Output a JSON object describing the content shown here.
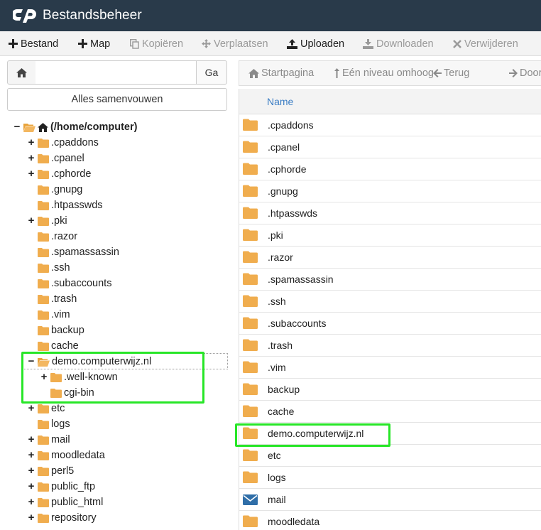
{
  "app": {
    "title": "Bestandsbeheer"
  },
  "toolbar": {
    "file": "Bestand",
    "folder": "Map",
    "copy": "Kopiëren",
    "move": "Verplaatsen",
    "upload": "Uploaden",
    "download": "Downloaden",
    "delete": "Verwijderen"
  },
  "left": {
    "path_value": "",
    "go_label": "Ga",
    "collapse_label": "Alles samenvouwen"
  },
  "tree": {
    "root": "(/home/computer)",
    "nodes": [
      {
        "label": ".cpaddons",
        "expandable": true
      },
      {
        "label": ".cpanel",
        "expandable": true
      },
      {
        "label": ".cphorde",
        "expandable": true
      },
      {
        "label": ".gnupg",
        "expandable": false
      },
      {
        "label": ".htpasswds",
        "expandable": false
      },
      {
        "label": ".pki",
        "expandable": true
      },
      {
        "label": ".razor",
        "expandable": false
      },
      {
        "label": ".spamassassin",
        "expandable": false
      },
      {
        "label": ".ssh",
        "expandable": false
      },
      {
        "label": ".subaccounts",
        "expandable": false
      },
      {
        "label": ".trash",
        "expandable": false
      },
      {
        "label": ".vim",
        "expandable": false
      },
      {
        "label": "backup",
        "expandable": false
      },
      {
        "label": "cache",
        "expandable": false
      },
      {
        "label": "demo.computerwijz.nl",
        "expandable": true,
        "expanded": true
      },
      {
        "label": ".well-known",
        "expandable": true,
        "child": true
      },
      {
        "label": "cgi-bin",
        "expandable": false,
        "child": true
      },
      {
        "label": "etc",
        "expandable": true
      },
      {
        "label": "logs",
        "expandable": false
      },
      {
        "label": "mail",
        "expandable": true
      },
      {
        "label": "moodledata",
        "expandable": true
      },
      {
        "label": "perl5",
        "expandable": true
      },
      {
        "label": "public_ftp",
        "expandable": true
      },
      {
        "label": "public_html",
        "expandable": true
      },
      {
        "label": "repository",
        "expandable": true
      }
    ]
  },
  "nav": {
    "home": "Startpagina",
    "up": "Eén niveau omhoog",
    "back": "Terug",
    "forward": "Door"
  },
  "table": {
    "col_name": "Name",
    "rows": [
      {
        "name": ".cpaddons",
        "type": "folder"
      },
      {
        "name": ".cpanel",
        "type": "folder"
      },
      {
        "name": ".cphorde",
        "type": "folder"
      },
      {
        "name": ".gnupg",
        "type": "folder"
      },
      {
        "name": ".htpasswds",
        "type": "folder"
      },
      {
        "name": ".pki",
        "type": "folder"
      },
      {
        "name": ".razor",
        "type": "folder"
      },
      {
        "name": ".spamassassin",
        "type": "folder"
      },
      {
        "name": ".ssh",
        "type": "folder"
      },
      {
        "name": ".subaccounts",
        "type": "folder"
      },
      {
        "name": ".trash",
        "type": "folder"
      },
      {
        "name": ".vim",
        "type": "folder"
      },
      {
        "name": "backup",
        "type": "folder"
      },
      {
        "name": "cache",
        "type": "folder"
      },
      {
        "name": "demo.computerwijz.nl",
        "type": "folder"
      },
      {
        "name": "etc",
        "type": "folder"
      },
      {
        "name": "logs",
        "type": "folder"
      },
      {
        "name": "mail",
        "type": "mail"
      },
      {
        "name": "moodledata",
        "type": "folder"
      }
    ]
  },
  "colors": {
    "titlebar": "#293a4a",
    "folder": "#f0ad4e",
    "highlight": "#27e627",
    "link": "#3b7dc4",
    "mail": "#2f6ea8"
  },
  "icons": {
    "logo": "cpanel-logo",
    "file": "plus-icon",
    "folder": "folder-icon",
    "home": "home-icon",
    "mail": "mail-icon"
  }
}
